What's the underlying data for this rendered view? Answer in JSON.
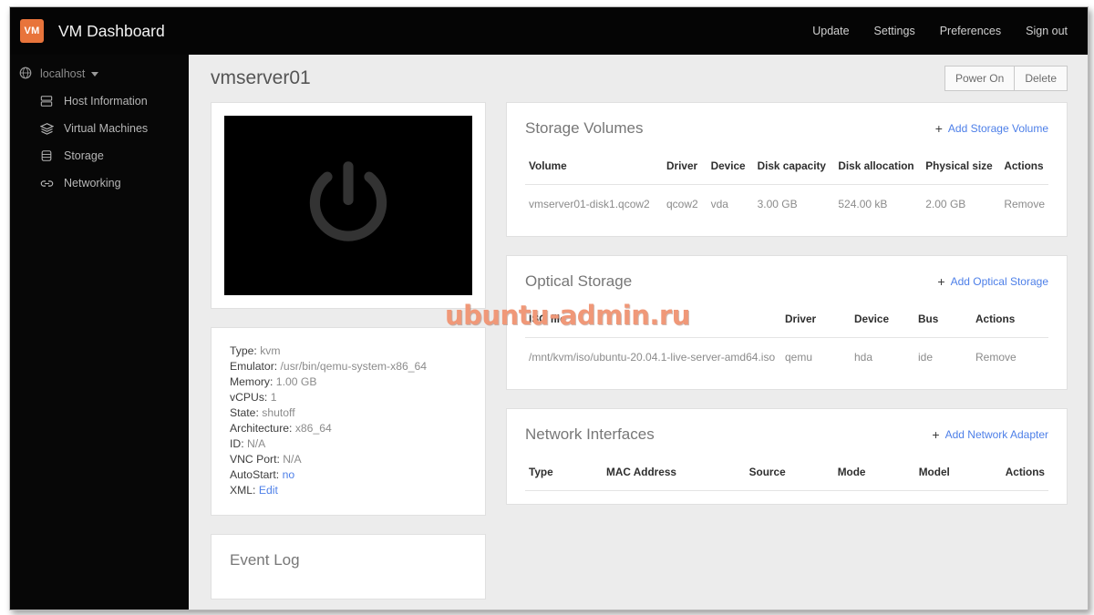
{
  "app": {
    "brand_badge": "VM",
    "brand_title": "VM Dashboard",
    "watermark": "ubuntu-admin.ru"
  },
  "topnav": {
    "items": [
      {
        "label": "Update",
        "icon": "update-icon"
      },
      {
        "label": "Settings",
        "icon": "settings-icon"
      },
      {
        "label": "Preferences",
        "icon": "preferences-icon"
      },
      {
        "label": "Sign out",
        "icon": "signout-icon"
      }
    ]
  },
  "sidebar": {
    "host": {
      "label": "localhost",
      "icon": "globe-icon",
      "caret": "chevron-down-icon"
    },
    "items": [
      {
        "label": "Host Information",
        "icon": "server-icon"
      },
      {
        "label": "Virtual Machines",
        "icon": "layers-icon"
      },
      {
        "label": "Storage",
        "icon": "database-icon"
      },
      {
        "label": "Networking",
        "icon": "link-icon"
      }
    ]
  },
  "page": {
    "title": "vmserver01",
    "actions": [
      {
        "label": "Power On"
      },
      {
        "label": "Delete"
      }
    ]
  },
  "console": {
    "icon": "power-icon",
    "screen_color": "#000000"
  },
  "details": {
    "rows": [
      {
        "key": "Type:",
        "value": "kvm",
        "link": false
      },
      {
        "key": "Emulator:",
        "value": "/usr/bin/qemu-system-x86_64",
        "link": false
      },
      {
        "key": "Memory:",
        "value": "1.00 GB",
        "link": false
      },
      {
        "key": "vCPUs:",
        "value": "1",
        "link": false
      },
      {
        "key": "State:",
        "value": "shutoff",
        "link": false
      },
      {
        "key": "Architecture:",
        "value": "x86_64",
        "link": false
      },
      {
        "key": "ID:",
        "value": "N/A",
        "link": false
      },
      {
        "key": "VNC Port:",
        "value": "N/A",
        "link": false
      },
      {
        "key": "AutoStart:",
        "value": "no",
        "link": true
      },
      {
        "key": "XML:",
        "value": "Edit",
        "link": true
      }
    ]
  },
  "event_log": {
    "title": "Event Log"
  },
  "storage_volumes": {
    "title": "Storage Volumes",
    "action_label": "Add Storage Volume",
    "action_plus": "+",
    "columns": [
      "Volume",
      "Driver",
      "Device",
      "Disk capacity",
      "Disk allocation",
      "Physical size",
      "Actions"
    ],
    "rows": [
      {
        "volume": "vmserver01-disk1.qcow2",
        "driver": "qcow2",
        "device": "vda",
        "disk_capacity": "3.00 GB",
        "disk_allocation": "524.00 kB",
        "physical_size": "2.00 GB",
        "action": "Remove"
      }
    ]
  },
  "optical_storage": {
    "title": "Optical Storage",
    "action_label": "Add Optical Storage",
    "action_plus": "+",
    "columns": [
      "ISO file",
      "Driver",
      "Device",
      "Bus",
      "Actions"
    ],
    "rows": [
      {
        "iso_file": "/mnt/kvm/iso/ubuntu-20.04.1-live-server-amd64.iso",
        "driver": "qemu",
        "device": "hda",
        "bus": "ide",
        "action": "Remove"
      }
    ]
  },
  "network_interfaces": {
    "title": "Network Interfaces",
    "action_label": "Add Network Adapter",
    "action_plus": "+",
    "columns": [
      "Type",
      "MAC Address",
      "Source",
      "Mode",
      "Model",
      "Actions"
    ],
    "rows": []
  },
  "colors": {
    "brand_orange": "#e8743b",
    "link_blue": "#4d7fe8",
    "topbar_black": "#050505",
    "sidebar_black": "#070707",
    "content_bg": "#ececec",
    "watermark": "#f09878"
  }
}
